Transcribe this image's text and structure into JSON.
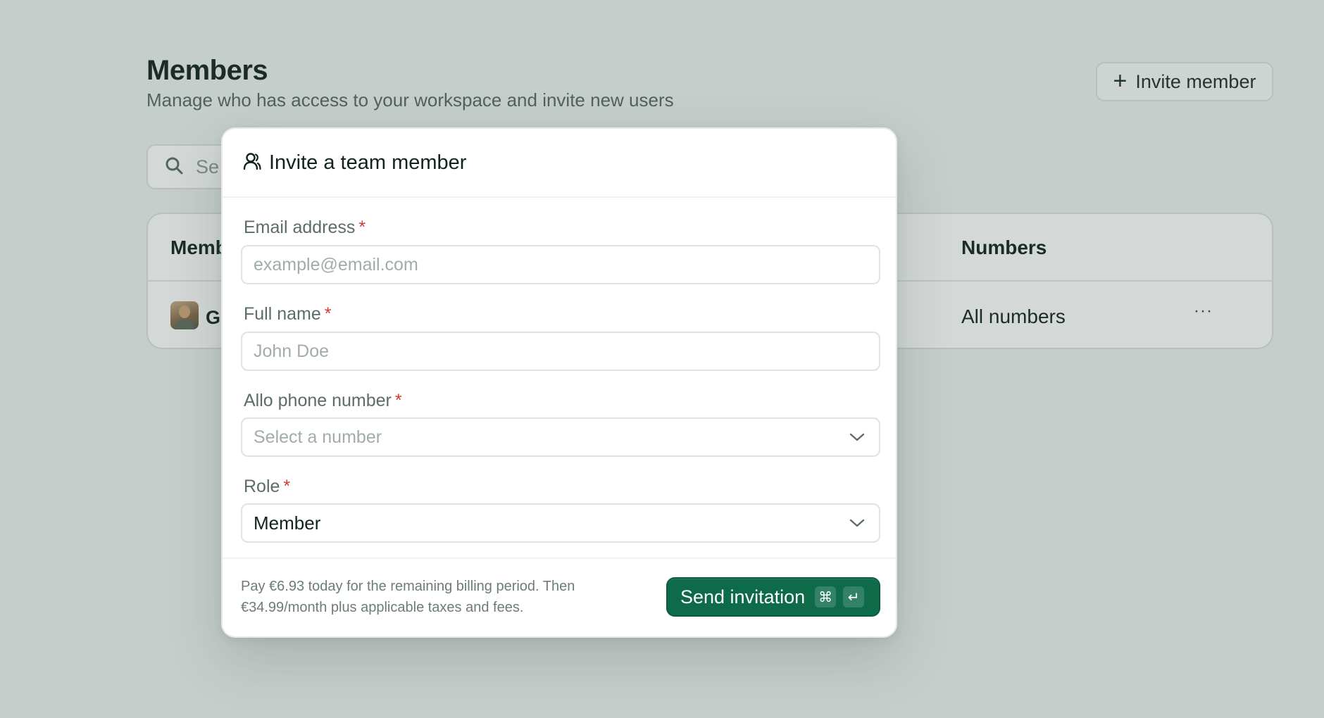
{
  "page": {
    "title": "Members",
    "subtitle": "Manage who has access to your workspace and invite new users",
    "invite_button": {
      "icon": "plus-icon",
      "label": "Invite member"
    },
    "search": {
      "icon": "search-icon",
      "placeholder_visible": "Se"
    },
    "table": {
      "columns": [
        "Memb",
        "Numbers"
      ],
      "rows": [
        {
          "name": "Gr",
          "numbers": "All numbers",
          "more": "···"
        }
      ]
    }
  },
  "modal": {
    "icon": "user-icon",
    "title": "Invite a team member",
    "fields": [
      {
        "label": "Email address",
        "required": "*",
        "placeholder": "example@email.com"
      },
      {
        "label": "Full name",
        "required": "*",
        "placeholder": "John Doe"
      },
      {
        "label": "Allo phone number",
        "required": "*",
        "placeholder": "Select a number"
      },
      {
        "label": "Role",
        "required": "*",
        "value": "Member"
      }
    ],
    "billing_text": "Pay €6.93 today for the remaining billing period. Then €34.99/month plus applicable taxes and fees.",
    "send_button": {
      "label": "Send invitation",
      "shortcut_cmd": "⌘",
      "shortcut_enter": "↵"
    }
  },
  "colors": {
    "accent": "#0d6b4a",
    "required": "#d23b31",
    "background": "#eef3f1"
  }
}
